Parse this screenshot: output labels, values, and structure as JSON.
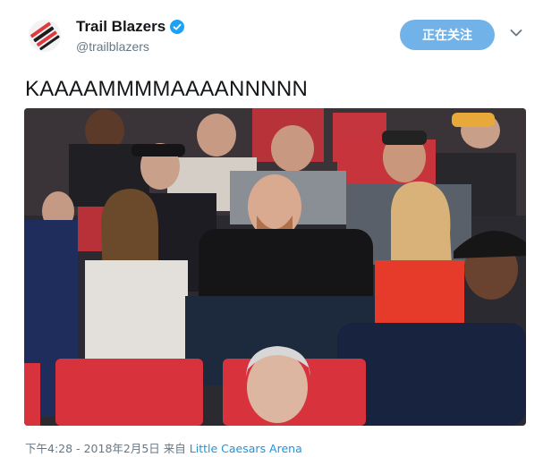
{
  "account": {
    "name": "Trail Blazers",
    "handle": "@trailblazers",
    "verified": true
  },
  "follow_button": {
    "label": "正在关注"
  },
  "tweet": {
    "text": "KAAAAMMMMAAAANNNNN"
  },
  "meta": {
    "time": "下午4:28",
    "separator": "-",
    "date": "2018年2月5日",
    "source_prefix": "来自",
    "place": "Little Caesars Arena"
  },
  "colors": {
    "accent": "#1da1f2",
    "follow_button_bg": "#71b3e8",
    "seat_red": "#d8323c"
  },
  "icons": {
    "avatar": "trail-blazers-logo-icon",
    "verified": "verified-badge-icon",
    "caret": "chevron-down-icon"
  }
}
